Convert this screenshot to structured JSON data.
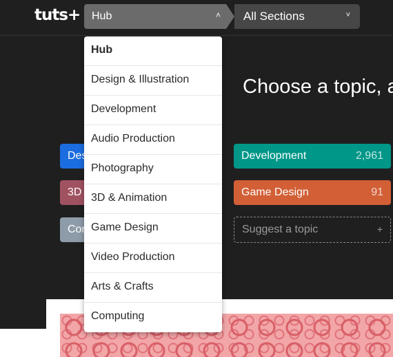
{
  "header": {
    "logo": "tuts+",
    "hub_label": "Hub",
    "hub_chevron": "˄",
    "sections_label": "All Sections",
    "sections_chevron": "˅"
  },
  "headline": "Choose a topic, a",
  "dropdown": {
    "items": [
      {
        "label": "Hub",
        "active": true
      },
      {
        "label": "Design & Illustration"
      },
      {
        "label": "Development"
      },
      {
        "label": "Audio Production"
      },
      {
        "label": "Photography"
      },
      {
        "label": "3D & Animation"
      },
      {
        "label": "Game Design"
      },
      {
        "label": "Video Production"
      },
      {
        "label": "Arts & Crafts"
      },
      {
        "label": "Computing"
      }
    ]
  },
  "tiles": {
    "left": [
      {
        "label": "Des",
        "color": "#1b6de0"
      },
      {
        "label": "3D",
        "color": "#a15261"
      },
      {
        "label": "Cor",
        "color": "#8e9ba8"
      }
    ],
    "right": [
      {
        "label": "Development",
        "count": "2,961",
        "color": "#009688"
      },
      {
        "label": "Game Design",
        "count": "91",
        "color": "#d25f36"
      }
    ],
    "suggest": {
      "label": "Suggest a topic",
      "plus": "+"
    }
  }
}
